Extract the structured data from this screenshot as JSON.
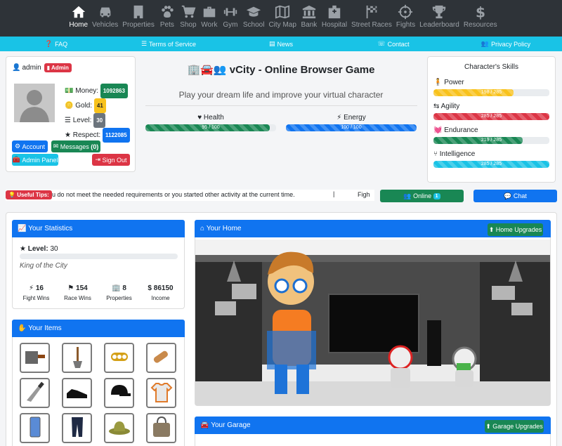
{
  "nav": {
    "items": [
      {
        "label": "Home",
        "icon": "home-icon"
      },
      {
        "label": "Vehicles",
        "icon": "car-icon"
      },
      {
        "label": "Properties",
        "icon": "building-icon"
      },
      {
        "label": "Pets",
        "icon": "paw-icon"
      },
      {
        "label": "Shop",
        "icon": "cart-icon"
      },
      {
        "label": "Work",
        "icon": "briefcase-icon"
      },
      {
        "label": "Gym",
        "icon": "dumbbell-icon"
      },
      {
        "label": "School",
        "icon": "graduation-cap-icon"
      },
      {
        "label": "City Map",
        "icon": "map-icon"
      },
      {
        "label": "Bank",
        "icon": "bank-icon"
      },
      {
        "label": "Hospital",
        "icon": "hospital-icon"
      },
      {
        "label": "Street Races",
        "icon": "flag-checkered-icon"
      },
      {
        "label": "Fights",
        "icon": "crosshair-icon"
      },
      {
        "label": "Leaderboard",
        "icon": "trophy-icon"
      },
      {
        "label": "Resources",
        "icon": "dollar-icon"
      }
    ]
  },
  "subnav": {
    "faq": "FAQ",
    "terms": "Terms of Service",
    "news": "News",
    "contact": "Contact",
    "privacy": "Privacy Policy"
  },
  "profile": {
    "username": "admin",
    "role_badge": "Admin",
    "money_label": "Money:",
    "money": "1092863",
    "gold_label": "Gold:",
    "gold": "41",
    "level_label": "Level:",
    "level": "30",
    "respect_label": "Respect:",
    "respect": "1122085",
    "account_btn": "Account",
    "messages_btn": "Messages",
    "messages_count": "(0)",
    "admin_btn": "Admin Panel",
    "signout_btn": "Sign Out"
  },
  "game": {
    "title": "vCity - Online Browser Game",
    "tagline": "Play your dream life and improve your virtual character",
    "health_label": "Health",
    "health_text": "95 / 100",
    "health_pct": 95,
    "energy_label": "Energy",
    "energy_text": "100 / 100",
    "energy_pct": 100
  },
  "skills": {
    "title": "Character's Skills",
    "items": [
      {
        "name": "Power",
        "text": "198 / 285",
        "pct": 69,
        "color": "#f8c21c"
      },
      {
        "name": "Agility",
        "text": "285 / 285",
        "pct": 100,
        "color": "#dc3545"
      },
      {
        "name": "Endurance",
        "text": "219 / 285",
        "pct": 77,
        "color": "#198754"
      },
      {
        "name": "Intelligence",
        "text": "285 / 285",
        "pct": 100,
        "color": "#19c3e6"
      }
    ]
  },
  "tips": {
    "label": "Useful Tips:",
    "text": "u do not meet the needed requirements or you started other activity at the current time.",
    "separator": "|",
    "next": "Figh"
  },
  "online": {
    "label": "Online",
    "count": "1"
  },
  "chat": {
    "label": "Chat"
  },
  "stats": {
    "title": "Your Statistics",
    "level_label": "Level:",
    "level": "30",
    "rank": "King of the City",
    "items": [
      {
        "value": "16",
        "label": "Fight Wins"
      },
      {
        "value": "154",
        "label": "Race Wins"
      },
      {
        "value": "8",
        "label": "Properties"
      },
      {
        "value": "86150",
        "label": "Income"
      }
    ]
  },
  "items_panel": {
    "title": "Your Items",
    "items": [
      "cleaver-icon",
      "shovel-icon",
      "brass-knuckles-icon",
      "rolling-pin-icon",
      "knife-icon",
      "shoe-icon",
      "cap-icon",
      "tshirt-icon",
      "phone-icon",
      "pants-icon",
      "hat-icon",
      "handbag-icon"
    ]
  },
  "home": {
    "title": "Your Home",
    "upgrades_btn": "Home Upgrades"
  },
  "garage": {
    "title": "Your Garage",
    "upgrades_btn": "Garage Upgrades"
  },
  "colors": {
    "primary": "#1074f0",
    "success": "#198754",
    "info": "#19c3e6",
    "danger": "#dc3545",
    "warning": "#f8c21c",
    "nav": "#2e3338"
  }
}
